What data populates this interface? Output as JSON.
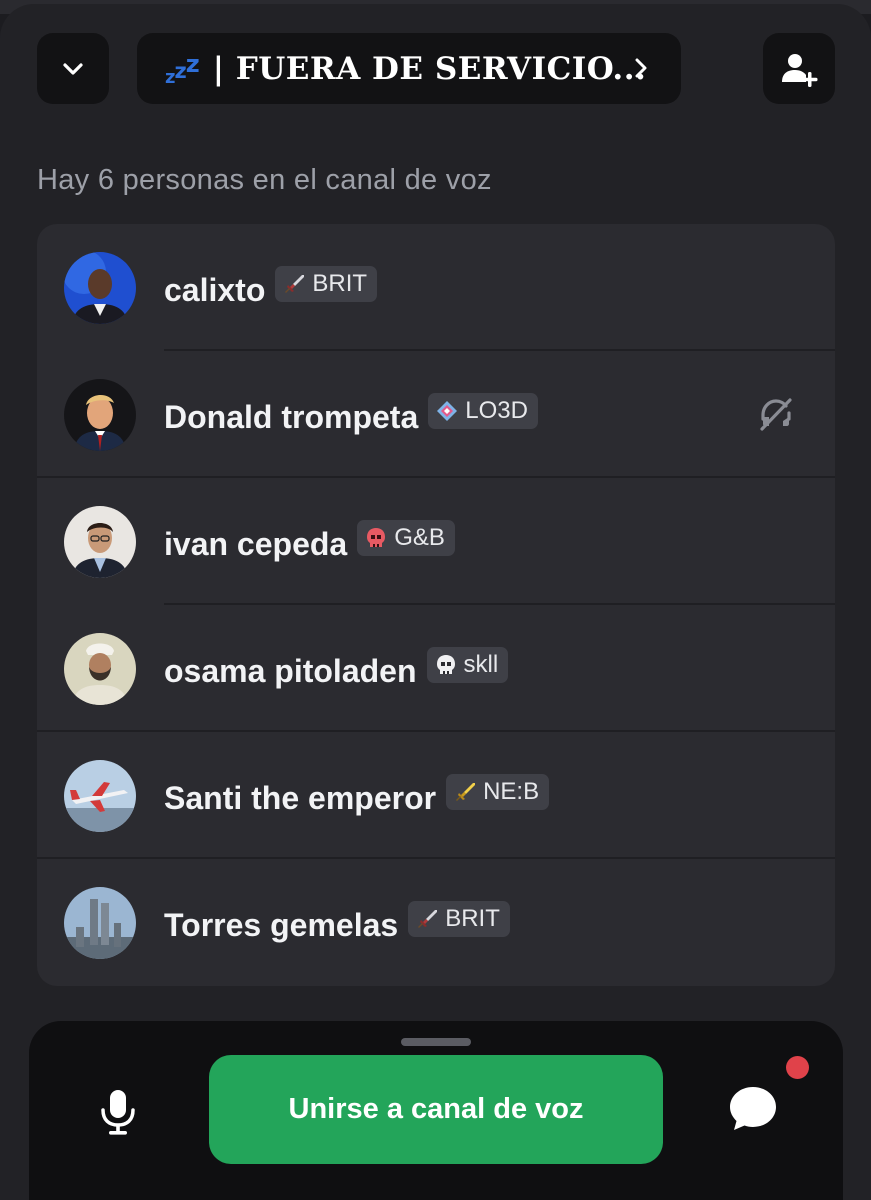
{
  "header": {
    "channel_name": "| FUERA DE SERVICIO...",
    "zzz_icon": "sleeping-zzz-emoji"
  },
  "people_count_text": "Hay 6 personas en el canal de voz",
  "members": [
    {
      "name": "calixto",
      "tag": "BRIT",
      "tag_icon": "sword-icon",
      "deafened": false
    },
    {
      "name": "Donald trompeta",
      "tag": "LO3D",
      "tag_icon": "diamond-icon",
      "deafened": true
    },
    {
      "name": "ivan cepeda",
      "tag": "G&B",
      "tag_icon": "red-skull-icon",
      "deafened": false
    },
    {
      "name": "osama pitoladen",
      "tag": "skll",
      "tag_icon": "skull-icon",
      "deafened": false
    },
    {
      "name": "Santi the emperor",
      "tag": "NE:B",
      "tag_icon": "gold-sword-icon",
      "deafened": false
    },
    {
      "name": "Torres gemelas",
      "tag": "BRIT",
      "tag_icon": "sword-icon",
      "deafened": false
    }
  ],
  "bottom": {
    "join_label": "Unirse a canal de voz"
  },
  "colors": {
    "join_green": "#23a55a",
    "notification_red": "#e0424a",
    "background": "#222226",
    "card": "#2b2b30"
  }
}
